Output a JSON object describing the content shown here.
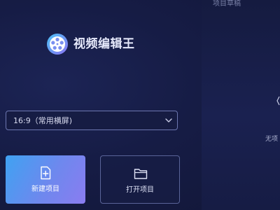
{
  "app": {
    "name": "视频编辑王",
    "logo_icon": "film-reel-icon"
  },
  "aspect_ratio": {
    "selected": "16:9（常用横屏)",
    "chevron_icon": "chevron-down-icon"
  },
  "actions": {
    "new_project": {
      "label": "新建项目",
      "icon": "new-file-plus-icon"
    },
    "open_project": {
      "label": "打开项目",
      "icon": "folder-icon"
    }
  },
  "drafts_panel": {
    "title": "项目草稿",
    "empty_text": "无项"
  },
  "colors": {
    "background": "#141a3d",
    "accent_gradient_start": "#3fa2f2",
    "accent_gradient_end": "#8a7cf0",
    "border": "#6d77b0"
  }
}
